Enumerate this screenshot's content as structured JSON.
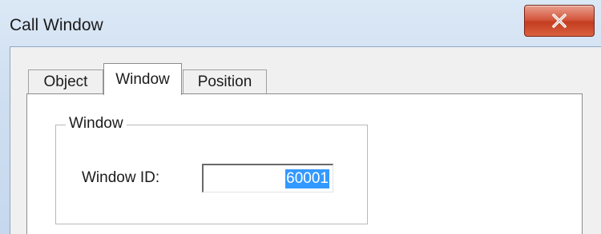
{
  "dialog": {
    "title": "Call Window",
    "close_label": "close"
  },
  "tabs": [
    {
      "label": "Object",
      "active": false
    },
    {
      "label": "Window",
      "active": true
    },
    {
      "label": "Position",
      "active": false
    }
  ],
  "window_group": {
    "legend": "Window",
    "window_id_label": "Window ID:",
    "window_id_value": "60001"
  },
  "colors": {
    "close_button": "#c43d20",
    "selection": "#3399ff"
  }
}
